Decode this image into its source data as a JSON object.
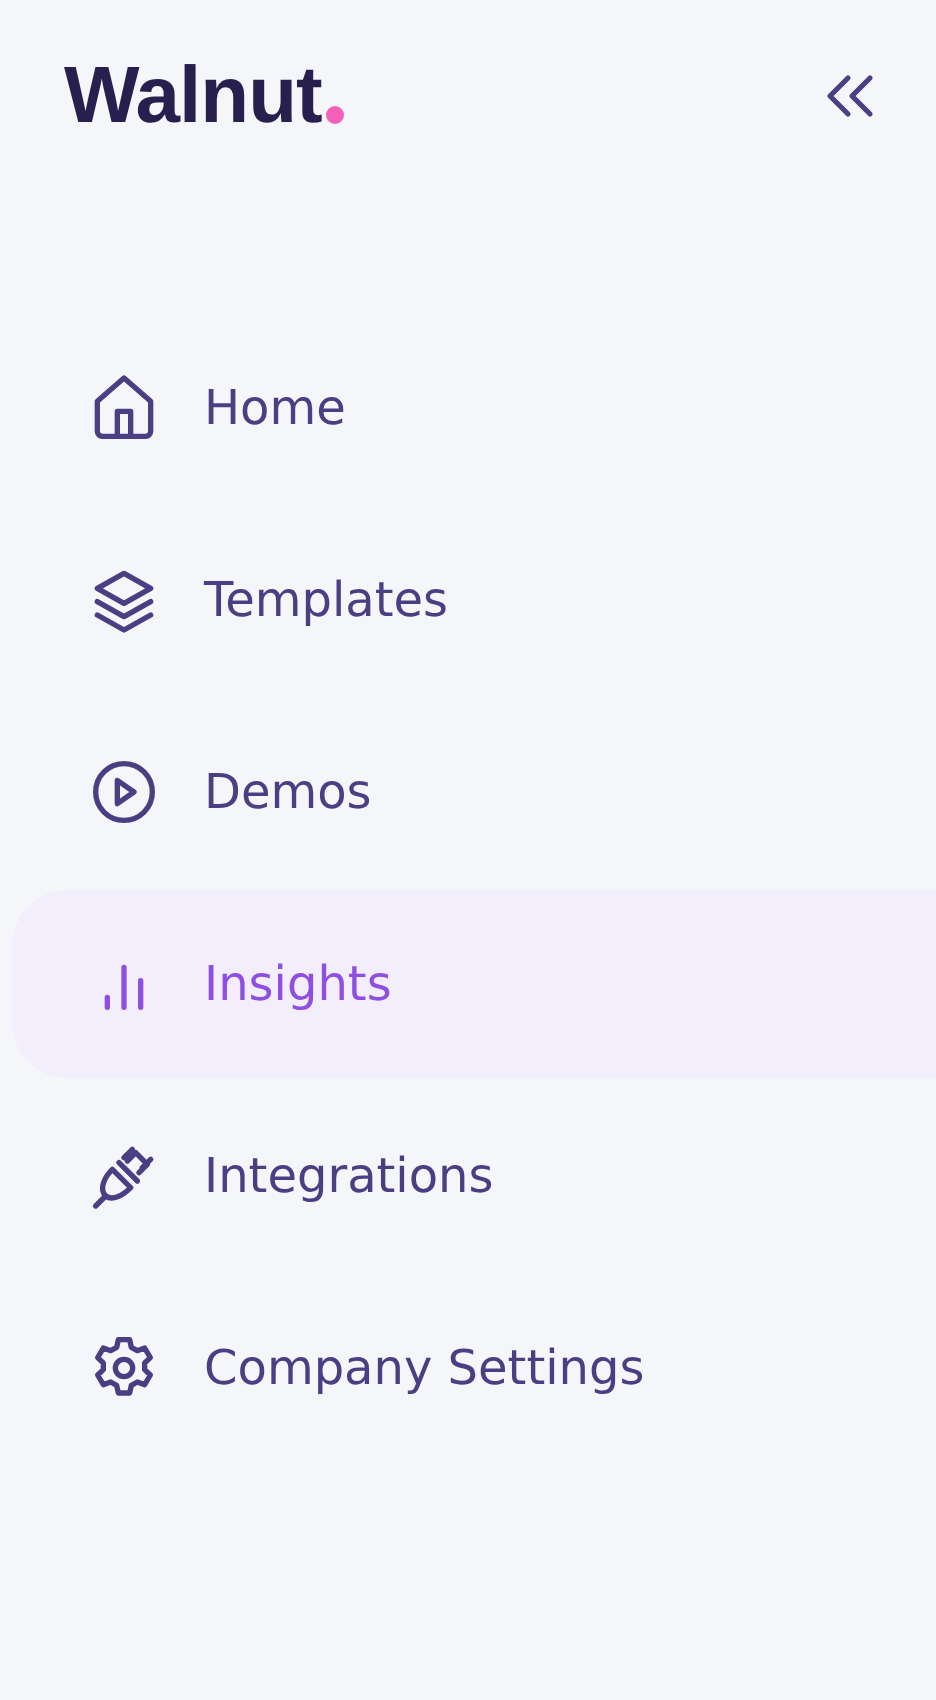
{
  "logo": {
    "text": "Walnut"
  },
  "nav": [
    {
      "label": "Home",
      "selected": false
    },
    {
      "label": "Templates",
      "selected": false
    },
    {
      "label": "Demos",
      "selected": false
    },
    {
      "label": "Insights",
      "selected": true
    },
    {
      "label": "Integrations",
      "selected": false
    },
    {
      "label": "Company Settings",
      "selected": false
    }
  ]
}
